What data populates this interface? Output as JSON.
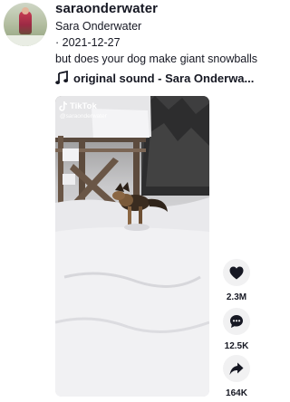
{
  "post": {
    "username": "saraonderwater",
    "display_name": "Sara Onderwater",
    "date": "· 2021-12-27",
    "caption": "but does your dog make giant snowballs",
    "sound": "original sound - Sara Onderwa...",
    "sound_icon": "music-note-icon"
  },
  "video": {
    "watermark_brand": "TikTok",
    "watermark_handle": "@saraonderwater"
  },
  "actions": {
    "likes": {
      "icon": "heart-icon",
      "count": "2.3M"
    },
    "comments": {
      "icon": "comment-icon",
      "count": "12.5K"
    },
    "shares": {
      "icon": "share-icon",
      "count": "164K"
    }
  },
  "colors": {
    "text": "#161823",
    "action_bg": "#f1f1f2",
    "background": "#ffffff"
  }
}
